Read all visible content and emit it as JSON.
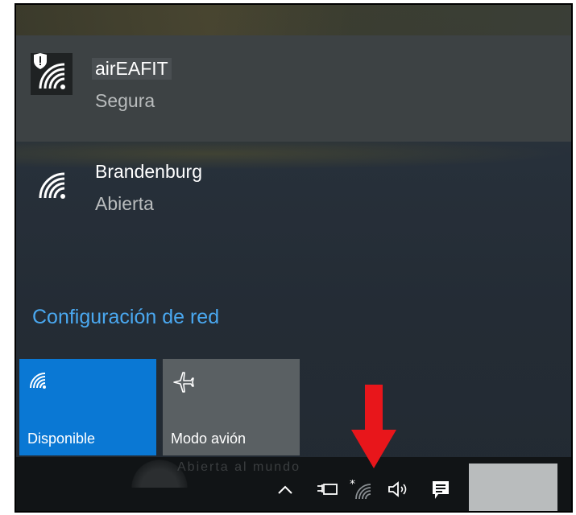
{
  "networks": [
    {
      "name": "airEAFIT",
      "status": "Segura",
      "selected": true,
      "secured": true
    },
    {
      "name": "Brandenburg",
      "status": "Abierta",
      "selected": false,
      "secured": false
    }
  ],
  "config_link": "Configuración de red",
  "tiles": [
    {
      "label": "Disponible",
      "icon": "wifi-icon",
      "color": "#0a78d4",
      "active": true
    },
    {
      "label": "Modo avión",
      "icon": "airplane-icon",
      "color": "#5a6063",
      "active": false
    }
  ],
  "taskbar": {
    "watermark": "Abierta al mundo",
    "icons": [
      "chevron-up-icon",
      "power-plug-icon",
      "wifi-icon",
      "volume-icon",
      "notifications-icon"
    ]
  },
  "annotation": {
    "icon": "red-arrow-down-icon",
    "color": "#e8161b"
  },
  "colors": {
    "accent": "#0a78d4",
    "link": "#4aa8f0"
  }
}
